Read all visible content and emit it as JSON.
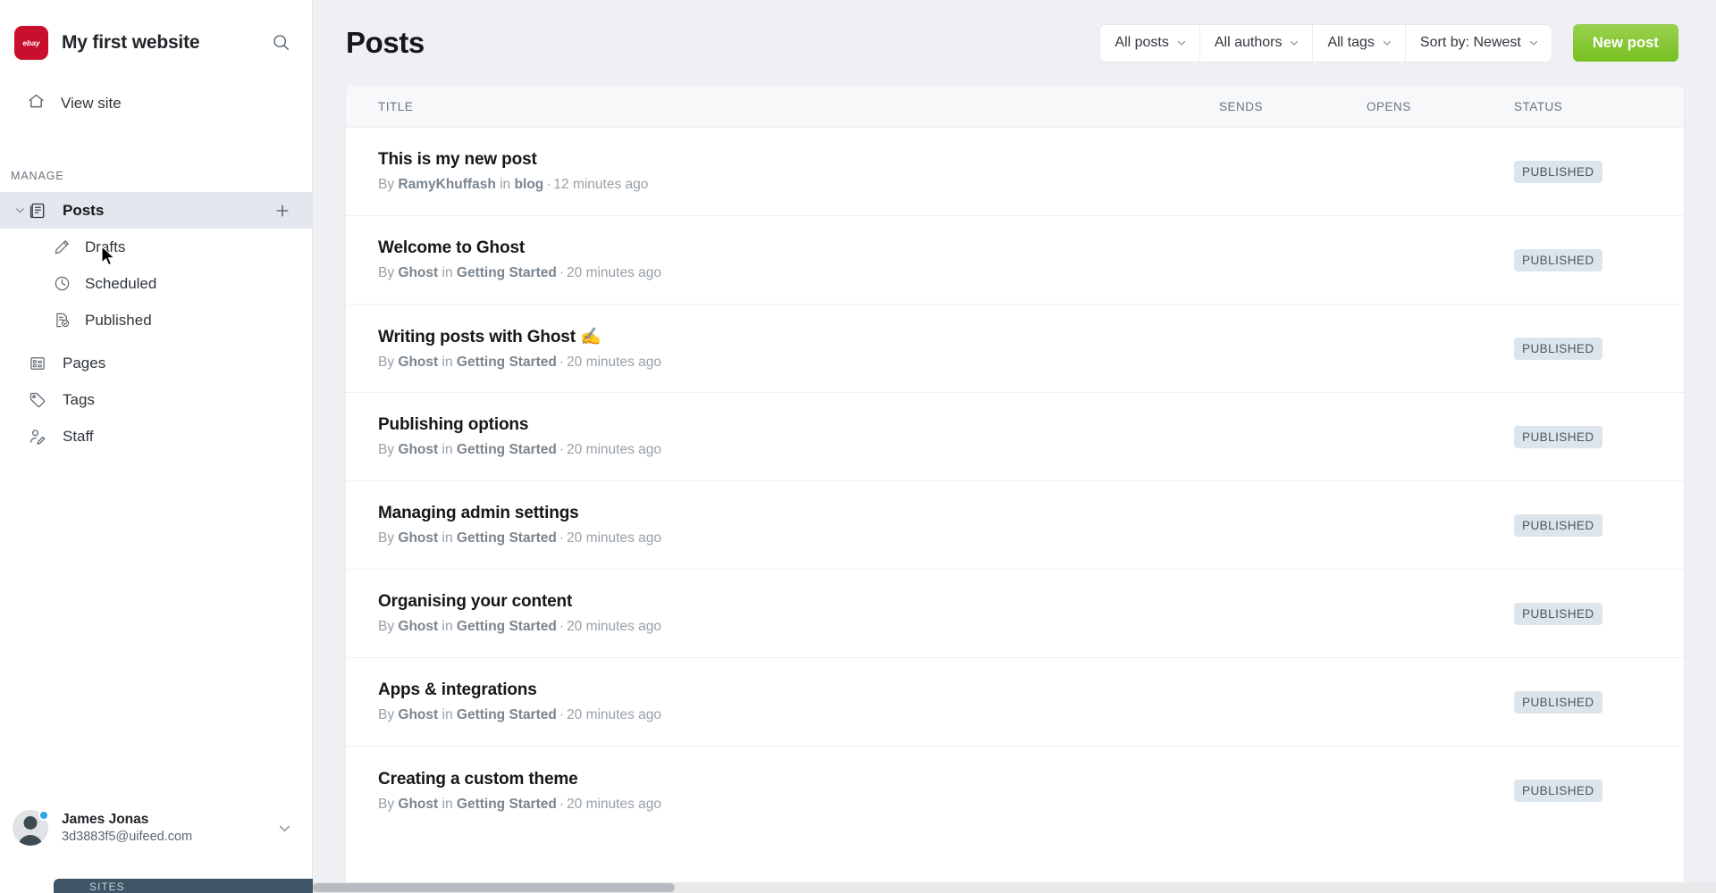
{
  "brand": {
    "logo_icon": "ebay-logo-icon",
    "logo_text": "ebay",
    "site_title": "My first website",
    "search_icon": "search-icon",
    "logo_color": "#c8102e"
  },
  "sidebar": {
    "view_site": {
      "label": "View site",
      "icon": "home-icon"
    },
    "section_label": "MANAGE",
    "nav": [
      {
        "label": "Posts",
        "icon": "posts-icon",
        "active": true,
        "expandable": true,
        "add_icon": "plus-icon"
      },
      {
        "label": "Drafts",
        "icon": "pencil-icon",
        "sub": true
      },
      {
        "label": "Scheduled",
        "icon": "clock-icon",
        "sub": true
      },
      {
        "label": "Published",
        "icon": "published-doc-icon",
        "sub": true
      },
      {
        "label": "Pages",
        "icon": "pages-icon"
      },
      {
        "label": "Tags",
        "icon": "tag-icon"
      },
      {
        "label": "Staff",
        "icon": "staff-icon"
      }
    ],
    "user": {
      "name": "James Jonas",
      "email": "3d3883f5@uifeed.com",
      "avatar_icon": "avatar-icon",
      "status_dot_color": "#29a4e8",
      "caret_icon": "chevron-down-icon"
    },
    "sites_strip_label": "SITES"
  },
  "header": {
    "title": "Posts",
    "filters": [
      {
        "label": "All posts",
        "icon": "chevron-down-icon"
      },
      {
        "label": "All authors",
        "icon": "chevron-down-icon"
      },
      {
        "label": "All tags",
        "icon": "chevron-down-icon"
      },
      {
        "label": "Sort by: Newest",
        "icon": "chevron-down-icon"
      }
    ],
    "new_post_label": "New post",
    "new_post_color": "#7ec321"
  },
  "table": {
    "columns": [
      "TITLE",
      "SENDS",
      "OPENS",
      "STATUS"
    ],
    "rows": [
      {
        "title": "This is my new post",
        "by_prefix": "By",
        "author": "RamyKhuffash",
        "in_word": "in",
        "tag": "blog",
        "time": "12 minutes ago",
        "sends": "",
        "opens": "",
        "status": "PUBLISHED"
      },
      {
        "title": "Welcome to Ghost",
        "by_prefix": "By",
        "author": "Ghost",
        "in_word": "in",
        "tag": "Getting Started",
        "time": "20 minutes ago",
        "sends": "",
        "opens": "",
        "status": "PUBLISHED"
      },
      {
        "title": "Writing posts with Ghost ✍️",
        "by_prefix": "By",
        "author": "Ghost",
        "in_word": "in",
        "tag": "Getting Started",
        "time": "20 minutes ago",
        "sends": "",
        "opens": "",
        "status": "PUBLISHED"
      },
      {
        "title": "Publishing options",
        "by_prefix": "By",
        "author": "Ghost",
        "in_word": "in",
        "tag": "Getting Started",
        "time": "20 minutes ago",
        "sends": "",
        "opens": "",
        "status": "PUBLISHED"
      },
      {
        "title": "Managing admin settings",
        "by_prefix": "By",
        "author": "Ghost",
        "in_word": "in",
        "tag": "Getting Started",
        "time": "20 minutes ago",
        "sends": "",
        "opens": "",
        "status": "PUBLISHED"
      },
      {
        "title": "Organising your content",
        "by_prefix": "By",
        "author": "Ghost",
        "in_word": "in",
        "tag": "Getting Started",
        "time": "20 minutes ago",
        "sends": "",
        "opens": "",
        "status": "PUBLISHED"
      },
      {
        "title": "Apps & integrations",
        "by_prefix": "By",
        "author": "Ghost",
        "in_word": "in",
        "tag": "Getting Started",
        "time": "20 minutes ago",
        "sends": "",
        "opens": "",
        "status": "PUBLISHED"
      },
      {
        "title": "Creating a custom theme",
        "by_prefix": "By",
        "author": "Ghost",
        "in_word": "in",
        "tag": "Getting Started",
        "time": "20 minutes ago",
        "sends": "",
        "opens": "",
        "status": "PUBLISHED"
      }
    ]
  }
}
